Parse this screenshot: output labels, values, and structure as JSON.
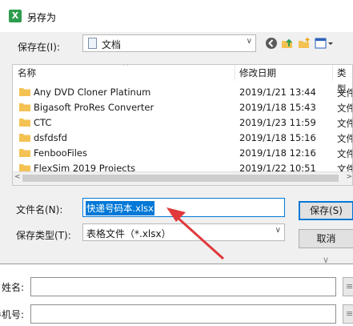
{
  "dialog": {
    "title": "另存为",
    "app_icon_letter": "X",
    "save_in_label": "保存在(I):",
    "save_in_value": "文档",
    "columns": {
      "name": "名称",
      "date": "修改日期",
      "type": "类型"
    },
    "files": [
      {
        "name": "Any DVD Cloner Platinum",
        "date": "2019/1/21 13:44",
        "type": "文件"
      },
      {
        "name": "Bigasoft ProRes Converter",
        "date": "2019/1/18 15:43",
        "type": "文件"
      },
      {
        "name": "CTC",
        "date": "2019/1/23 11:59",
        "type": "文件"
      },
      {
        "name": "dsfdsfd",
        "date": "2019/1/18 15:16",
        "type": "文件"
      },
      {
        "name": "FenbooFiles",
        "date": "2019/1/18 12:16",
        "type": "文件"
      },
      {
        "name": "FlexSim 2019 Projects",
        "date": "2019/1/22 10:51",
        "type": "文件"
      }
    ],
    "filename_label": "文件名(N):",
    "filename_value": "快递号码本.xlsx",
    "filetype_label": "保存类型(T):",
    "filetype_value": "表格文件（*.xlsx）",
    "save_button": "保存(S)",
    "cancel_button": "取消"
  },
  "form": {
    "name_label": "姓名:",
    "phone_label": "手机号:",
    "side_button_glyph": "≡"
  },
  "colors": {
    "accent": "#0078d7",
    "arrow": "#e0393b",
    "folder": "#f4c253"
  }
}
